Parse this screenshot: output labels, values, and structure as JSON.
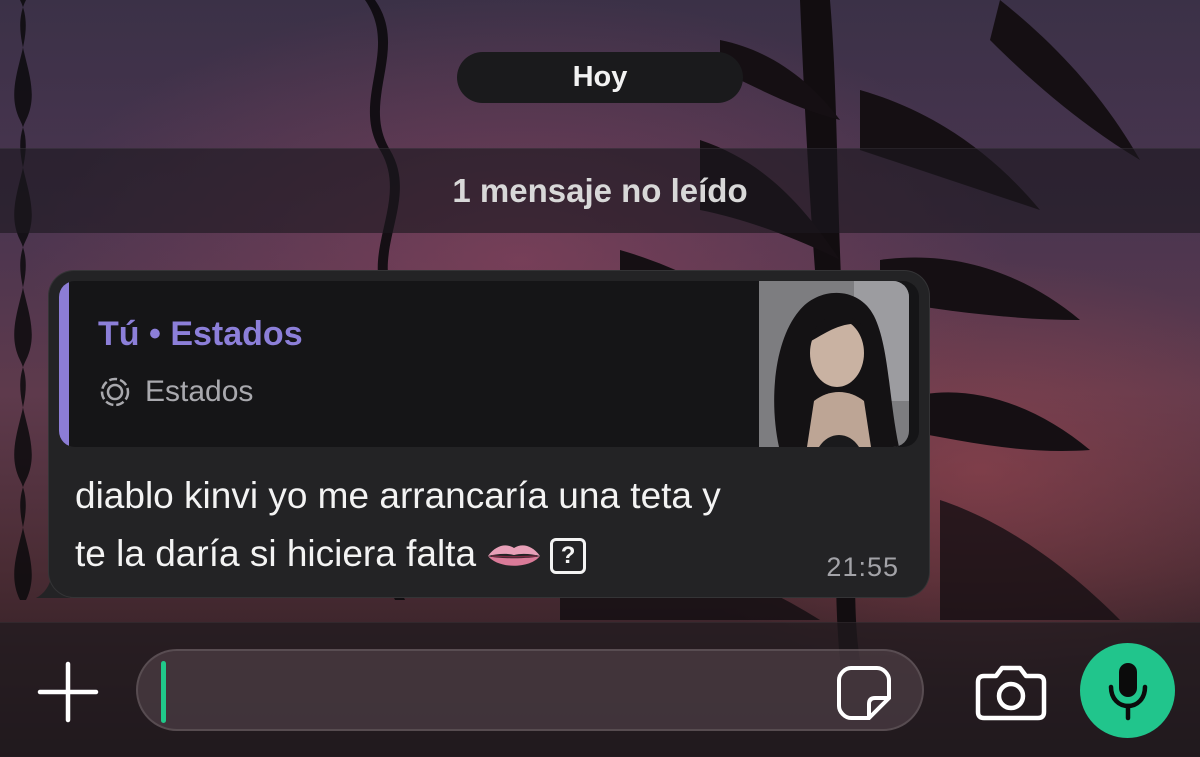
{
  "chat": {
    "date_separator": "Hoy",
    "unread_banner": "1 mensaje no leído"
  },
  "message": {
    "quote": {
      "author": "Tú • Estados",
      "source": "Estados",
      "source_icon": "status-icon",
      "thumbnail": "status-photo-thumbnail"
    },
    "text_line1": "diablo kinvi yo me arrancaría una teta y",
    "text_line2": "te la daría si hiciera falta",
    "emoji": "lips-emoji",
    "unknown_glyph": "?",
    "time": "21:55"
  },
  "composer": {
    "attach_icon": "plus-icon",
    "sticker_icon": "sticker-icon",
    "camera_icon": "camera-icon",
    "mic_icon": "microphone-icon"
  },
  "colors": {
    "accent": "#21c58c",
    "quote_author": "#8c7fd9",
    "bubble": "#232325"
  }
}
